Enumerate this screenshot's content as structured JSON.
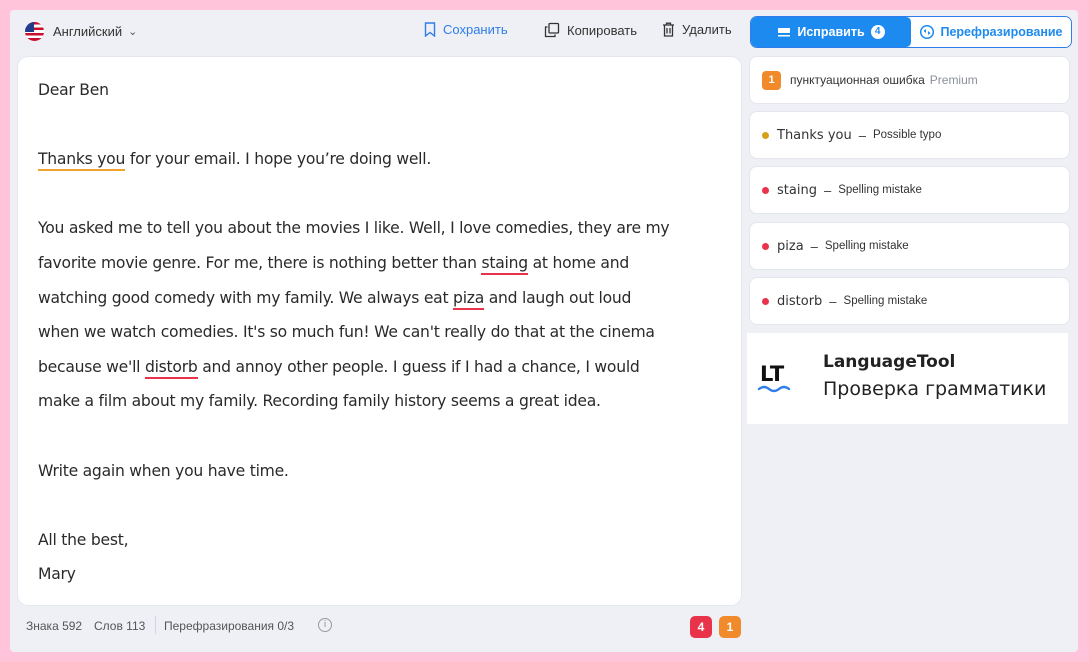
{
  "language": {
    "label": "Английский"
  },
  "toolbar": {
    "save_label": "Сохранить",
    "copy_label": "Копировать",
    "delete_label": "Удалить"
  },
  "editor": {
    "greeting": "Dear Ben",
    "p1": {
      "err": "Thanks you",
      "rest": " for your  email. I hope you’re doing well."
    },
    "p2": {
      "line1": "You asked me to tell you about the movies I like. Well, I love  comedies, they are my",
      "line2a": "favorite movie genre. For me, there is nothing better than ",
      "err1": "staing",
      "line2b": " at home and",
      "line3a": "watching good comedy with my family. We always eat ",
      "err2": "piza",
      "line3b": " and laugh out loud",
      "line4": "when we watch comedies. It's so much fun! We can't really do that at the cinema",
      "line5a": "because we'll ",
      "err3": "distorb",
      "line5b": " and annoy other people. I guess if I had a chance, I would",
      "line6": "make a film about my family. Recording family history seems a great idea."
    },
    "p3": "Write again when you have time.",
    "closing": "All the best,",
    "signature": "Mary"
  },
  "status": {
    "chars": "Знака 592",
    "words": "Слов 113",
    "paraphrase": "Перефразирования 0/3",
    "info_icon": "i",
    "spelling_count": "4",
    "punct_count": "1"
  },
  "tabs": {
    "fix_label": "Исправить",
    "fix_count": "4",
    "paraphrase_label": "Перефразирование"
  },
  "issues": {
    "premium": {
      "count": "1",
      "title": "пунктуационная ошибка",
      "tag": "Premium"
    },
    "items": [
      {
        "word": "Thanks you",
        "desc": "Possible typo",
        "color": "#d4a017"
      },
      {
        "word": "staing",
        "desc": "Spelling mistake",
        "color": "#e8334a"
      },
      {
        "word": "piza",
        "desc": "Spelling mistake",
        "color": "#e8334a"
      },
      {
        "word": "distorb",
        "desc": "Spelling mistake",
        "color": "#e8334a"
      }
    ]
  },
  "promo": {
    "logo_text": "LT",
    "name": "LanguageTool",
    "subtitle": "Проверка грамматики"
  },
  "colors": {
    "accent": "#1d8af0",
    "spelling": "#e8334a",
    "punctuation": "#f08a2a",
    "typo": "#f0a32e",
    "background": "#ffc4da"
  }
}
